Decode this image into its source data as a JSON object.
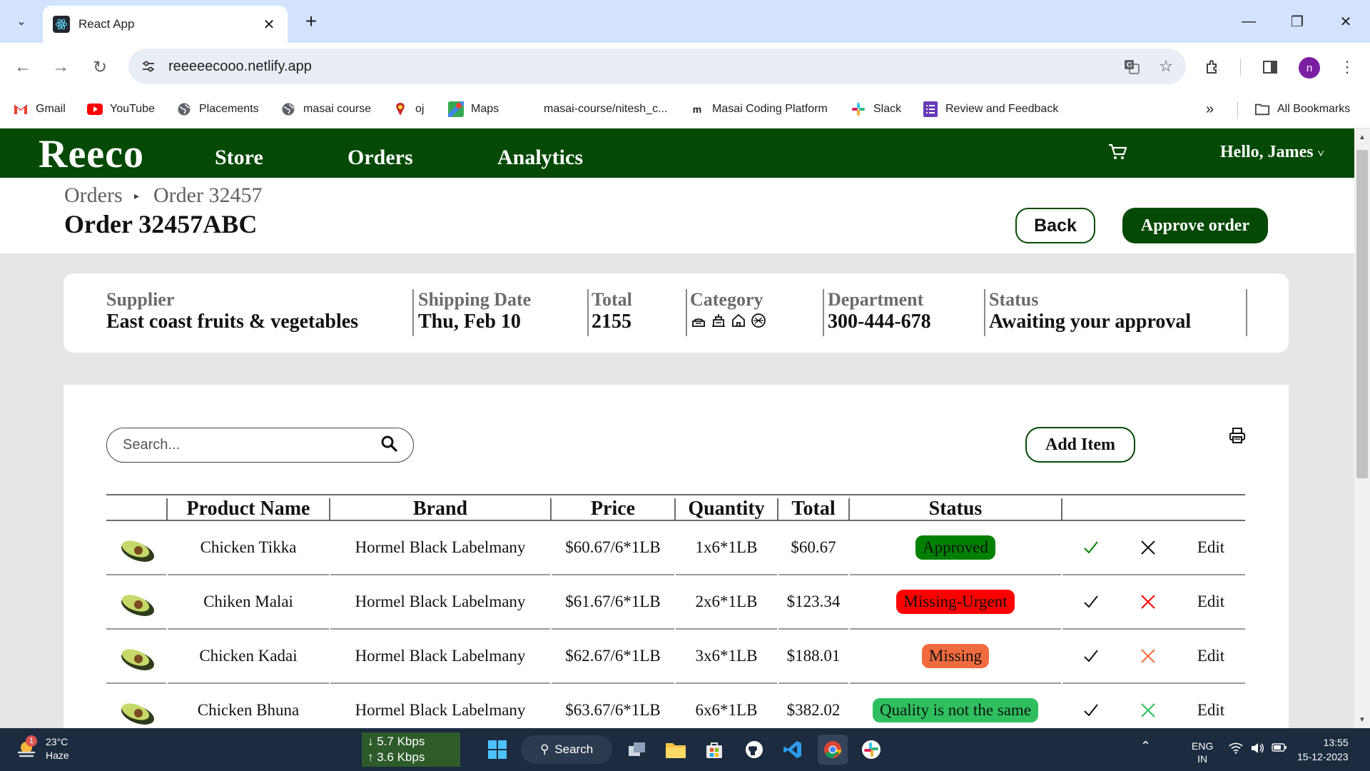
{
  "browser": {
    "tab_title": "React App",
    "url": "reeeeecooo.netlify.app",
    "profile_initial": "n",
    "bookmarks": [
      {
        "label": "Gmail",
        "icon": "gmail-icon"
      },
      {
        "label": "YouTube",
        "icon": "youtube-icon"
      },
      {
        "label": "Placements",
        "icon": "globe-icon"
      },
      {
        "label": "masai course",
        "icon": "globe-icon"
      },
      {
        "label": "oj",
        "icon": "oj-icon"
      },
      {
        "label": "Maps",
        "icon": "maps-icon"
      },
      {
        "label": "masai-course/nitesh_c...",
        "icon": "none"
      },
      {
        "label": "Masai Coding Platform",
        "icon": "masai-icon"
      },
      {
        "label": "Slack",
        "icon": "slack-icon"
      },
      {
        "label": "Review and Feedback",
        "icon": "forms-icon"
      }
    ],
    "all_bookmarks": "All Bookmarks"
  },
  "app": {
    "brand": "Reeco",
    "nav": {
      "store": "Store",
      "orders": "Orders",
      "analytics": "Analytics"
    },
    "greeting": "Hello, James",
    "greeting_caret": "˅"
  },
  "header": {
    "breadcrumb": [
      "Orders",
      "Order 32457"
    ],
    "breadcrumb_sep": "›",
    "title": "Order 32457ABC",
    "back": "Back",
    "approve": "Approve order"
  },
  "info": {
    "supplier": {
      "label": "Supplier",
      "value": "East coast fruits & vegetables"
    },
    "shipping": {
      "label": "Shipping Date",
      "value": "Thu, Feb 10"
    },
    "total": {
      "label": "Total",
      "value": "2155"
    },
    "category": {
      "label": "Category",
      "icons": [
        "bread-icon",
        "food-box-icon",
        "home-icon",
        "bowl-icon"
      ]
    },
    "department": {
      "label": "Department",
      "value": "300-444-678"
    },
    "status": {
      "label": "Status",
      "value": "Awaiting your approval"
    }
  },
  "toolbar": {
    "search_placeholder": "Search...",
    "add_item": "Add Item"
  },
  "table": {
    "columns": [
      "",
      "Product Name",
      "Brand",
      "Price",
      "Quantity",
      "Total",
      "Status"
    ],
    "rows": [
      {
        "name": "Chicken Tikka",
        "brand": "Hormel Black Labelmany",
        "price": "$60.67/6*1LB",
        "qty": "1x6*1LB",
        "total": "$60.67",
        "status": "Approved",
        "status_color": "#008000",
        "approve_color": "#008000",
        "reject_color": "#111111",
        "edit": "Edit"
      },
      {
        "name": "Chiken Malai",
        "brand": "Hormel Black Labelmany",
        "price": "$61.67/6*1LB",
        "qty": "2x6*1LB",
        "total": "$123.34",
        "status": "Missing-Urgent",
        "status_color": "#ff0000",
        "approve_color": "#111111",
        "reject_color": "#ff0000",
        "edit": "Edit"
      },
      {
        "name": "Chicken Kadai",
        "brand": "Hormel Black Labelmany",
        "price": "$62.67/6*1LB",
        "qty": "3x6*1LB",
        "total": "$188.01",
        "status": "Missing",
        "status_color": "#f26b3f",
        "approve_color": "#111111",
        "reject_color": "#f26b3f",
        "edit": "Edit"
      },
      {
        "name": "Chicken Bhuna",
        "brand": "Hormel Black Labelmany",
        "price": "$63.67/6*1LB",
        "qty": "6x6*1LB",
        "total": "$382.02",
        "status": "Quality is not the same",
        "status_color": "#2fbf5f",
        "approve_color": "#111111",
        "reject_color": "#2fbf5f",
        "edit": "Edit"
      }
    ]
  },
  "taskbar": {
    "weather_temp": "23°C",
    "weather_desc": "Haze",
    "weather_badge": "1",
    "net_down": "↓ 5.7 Kbps",
    "net_up": "↑ 3.6 Kbps",
    "search": "Search",
    "lang": "ENG",
    "region": "IN",
    "time": "13:55",
    "date": "15-12-2023"
  }
}
